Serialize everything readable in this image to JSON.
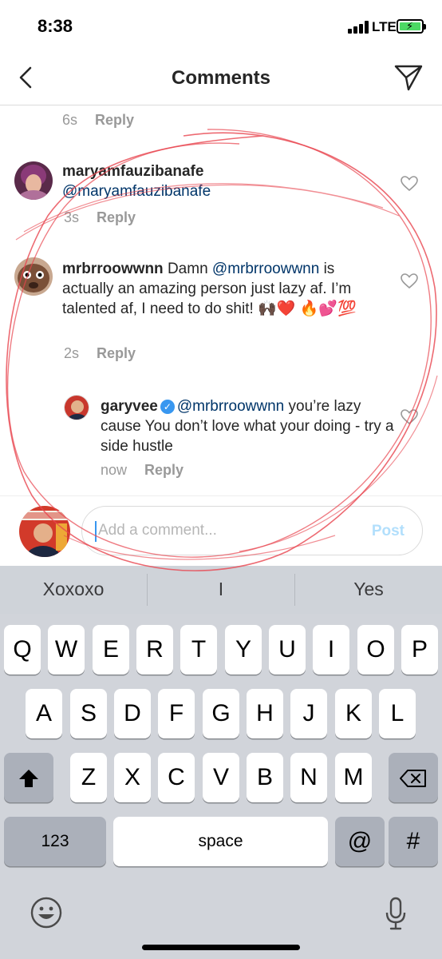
{
  "status_bar": {
    "time": "8:38",
    "network": "LTE",
    "battery_level": 1.0,
    "battery_color": "#4cd964"
  },
  "header": {
    "title": "Comments",
    "back_icon": "chevron-left-icon",
    "send_icon": "paper-plane-icon"
  },
  "comments": [
    {
      "time": "6s",
      "reply_label": "Reply"
    },
    {
      "username": "maryamfauzibanafe",
      "text": "@maryamfauzibanafe",
      "time": "3s",
      "reply_label": "Reply"
    },
    {
      "username": "mrbrroowwnn",
      "text_prefix": "Damn ",
      "mention": "@mrbrroowwnn",
      "text_rest": " is actually an amazing person just lazy af. I’m talented af, I need to do shit! 🙌🏿❤️ 🔥💕💯",
      "time": "2s",
      "reply_label": "Reply"
    },
    {
      "username": "garyvee",
      "verified": true,
      "mention": "@mrbrroowwnn",
      "text_rest": " you’re lazy cause You don’t love what your doing - try a side hustle",
      "time": "now",
      "reply_label": "Reply"
    }
  ],
  "composer": {
    "placeholder": "Add a comment...",
    "post_label": "Post",
    "post_color": "#b2dffc"
  },
  "keyboard": {
    "suggestions": [
      "Xoxoxo",
      "I",
      "Yes"
    ],
    "row1": [
      "Q",
      "W",
      "E",
      "R",
      "T",
      "Y",
      "U",
      "I",
      "O",
      "P"
    ],
    "row2": [
      "A",
      "S",
      "D",
      "F",
      "G",
      "H",
      "J",
      "K",
      "L"
    ],
    "row3": [
      "Z",
      "X",
      "C",
      "V",
      "B",
      "N",
      "M"
    ],
    "numbers_label": "123",
    "space_label": "space",
    "at_label": "@",
    "hash_label": "#",
    "shift_icon": "shift-icon",
    "delete_icon": "delete-icon",
    "emoji_icon": "emoji-icon",
    "mic_icon": "microphone-icon"
  },
  "annotation_color": "#e8454f"
}
